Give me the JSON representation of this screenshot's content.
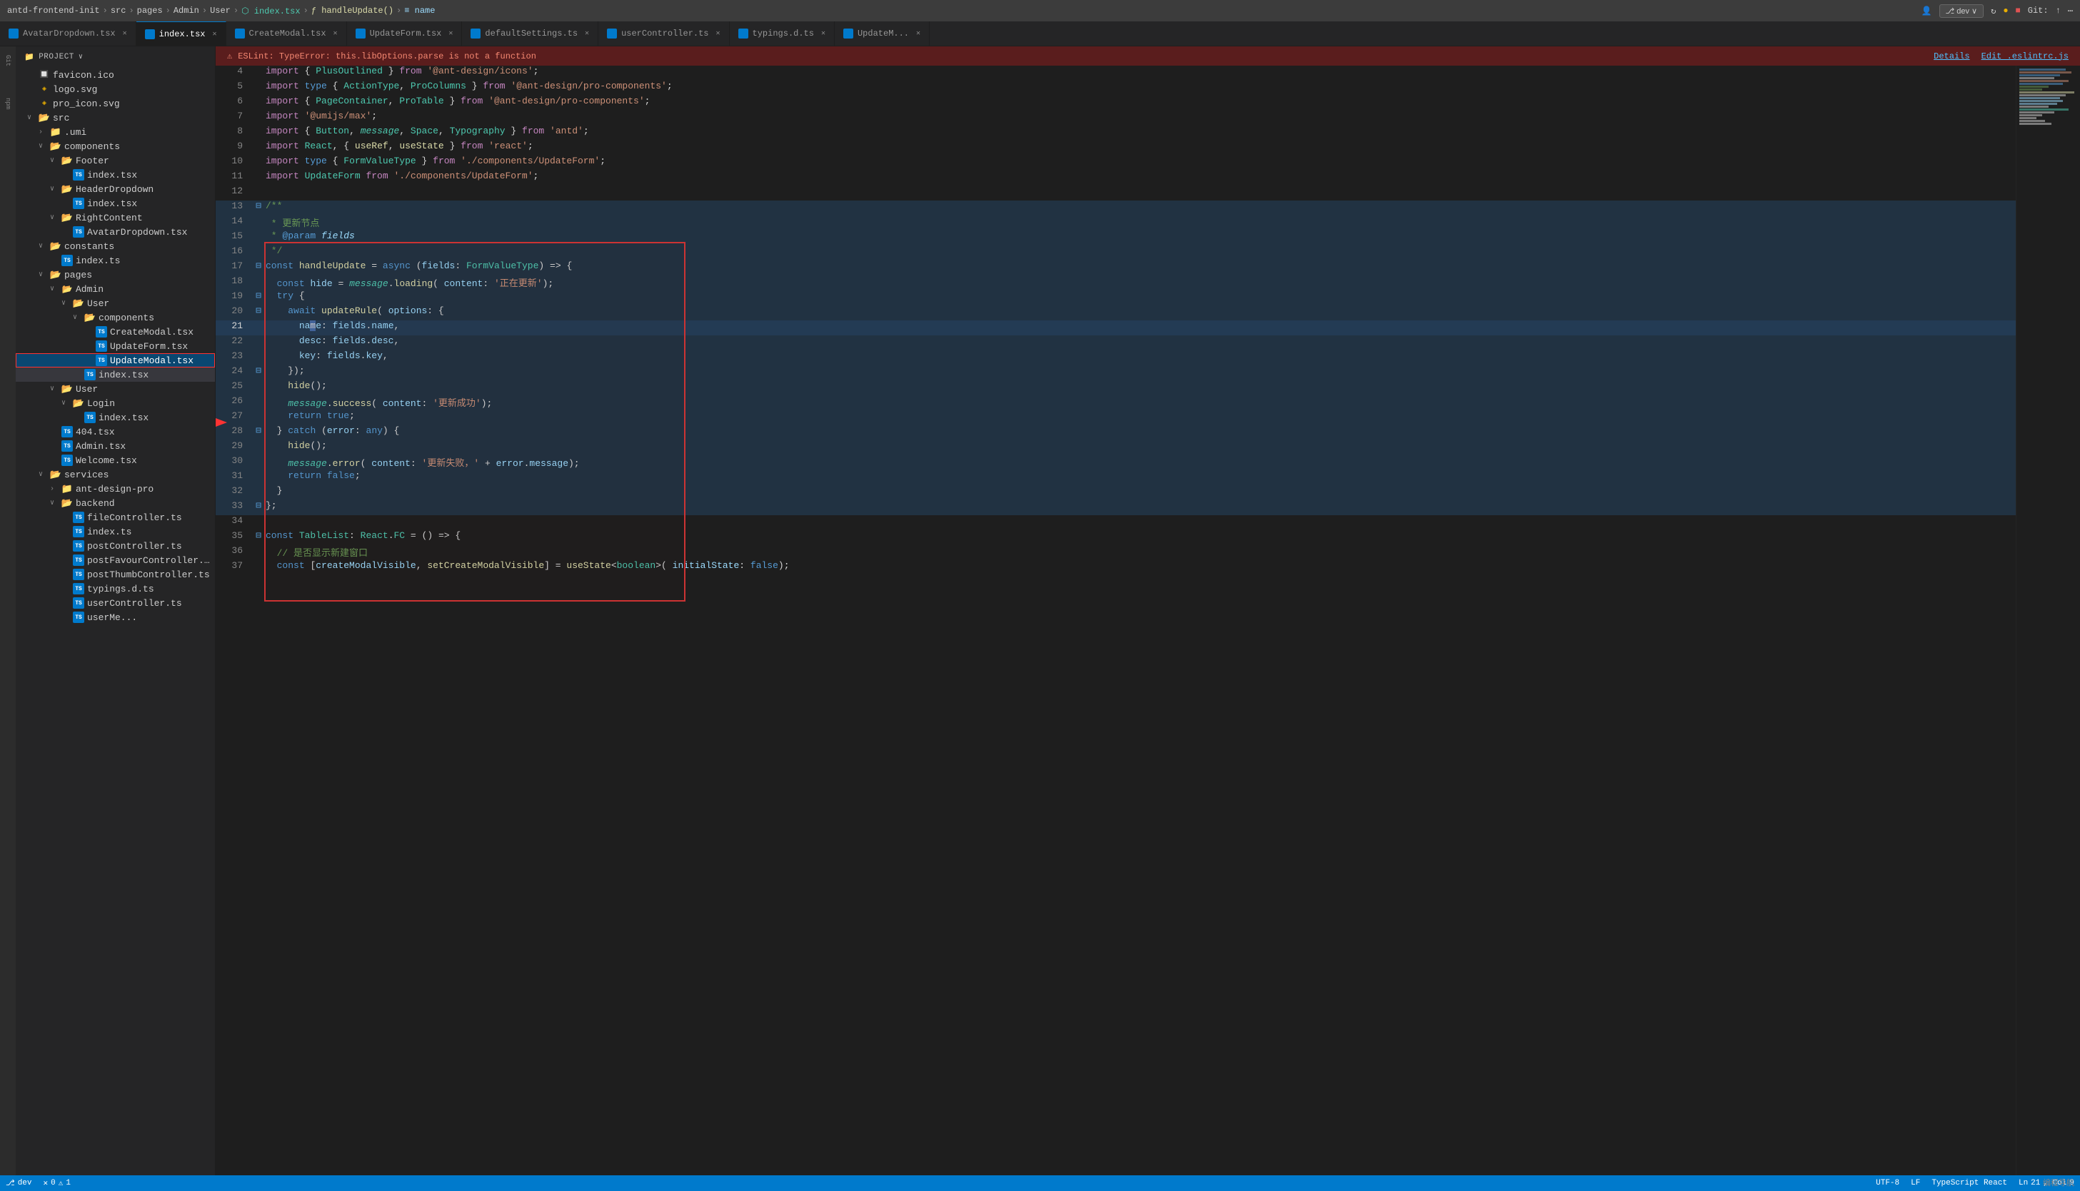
{
  "topbar": {
    "breadcrumb": [
      "antd-frontend-init",
      "src",
      "pages",
      "Admin",
      "User",
      "index.tsx",
      "handleUpdate()",
      "name"
    ],
    "rightItems": [
      "user-icon",
      "dev",
      "branch-icon",
      "git-label"
    ],
    "git_label": "Git:"
  },
  "tabs": [
    {
      "label": "AvatarDropdown.tsx",
      "type": "tsx",
      "active": false,
      "dirty": false
    },
    {
      "label": "index.tsx",
      "type": "tsx",
      "active": true,
      "dirty": false
    },
    {
      "label": "CreateModal.tsx",
      "type": "tsx",
      "active": false,
      "dirty": false
    },
    {
      "label": "UpdateForm.tsx",
      "type": "tsx",
      "active": false,
      "dirty": false
    },
    {
      "label": "defaultSettings.ts",
      "type": "ts",
      "active": false,
      "dirty": false
    },
    {
      "label": "userController.ts",
      "type": "ts",
      "active": false,
      "dirty": false
    },
    {
      "label": "typings.d.ts",
      "type": "ts",
      "active": false,
      "dirty": false
    },
    {
      "label": "UpdateM...",
      "type": "tsx",
      "active": false,
      "dirty": false
    }
  ],
  "error_banner": {
    "icon": "⚠",
    "text": "ESLint: TypeError: this.libOptions.parse is not a function",
    "details_label": "Details",
    "edit_label": "Edit .eslintrc.js"
  },
  "sidebar": {
    "header": "Project",
    "items": [
      {
        "label": "favicon.ico",
        "type": "ico",
        "depth": 1,
        "expanded": false
      },
      {
        "label": "logo.svg",
        "type": "svg",
        "depth": 1
      },
      {
        "label": "pro_icon.svg",
        "type": "svg",
        "depth": 1
      },
      {
        "label": "src",
        "type": "folder",
        "depth": 1,
        "expanded": true
      },
      {
        "label": ".umi",
        "type": "folder",
        "depth": 2,
        "expanded": false
      },
      {
        "label": "components",
        "type": "folder",
        "depth": 2,
        "expanded": true
      },
      {
        "label": "Footer",
        "type": "folder",
        "depth": 3,
        "expanded": true
      },
      {
        "label": "index.tsx",
        "type": "tsx",
        "depth": 4
      },
      {
        "label": "HeaderDropdown",
        "type": "folder",
        "depth": 3,
        "expanded": true
      },
      {
        "label": "index.tsx",
        "type": "tsx",
        "depth": 4
      },
      {
        "label": "RightContent",
        "type": "folder",
        "depth": 3,
        "expanded": true
      },
      {
        "label": "AvatarDropdown.tsx",
        "type": "tsx",
        "depth": 4
      },
      {
        "label": "constants",
        "type": "folder",
        "depth": 2,
        "expanded": true
      },
      {
        "label": "index.ts",
        "type": "ts",
        "depth": 3
      },
      {
        "label": "pages",
        "type": "folder",
        "depth": 2,
        "expanded": true
      },
      {
        "label": "Admin",
        "type": "folder",
        "depth": 3,
        "expanded": true
      },
      {
        "label": "User",
        "type": "folder",
        "depth": 4,
        "expanded": true
      },
      {
        "label": "components",
        "type": "folder",
        "depth": 5,
        "expanded": true
      },
      {
        "label": "CreateModal.tsx",
        "type": "tsx",
        "depth": 6
      },
      {
        "label": "UpdateForm.tsx",
        "type": "tsx",
        "depth": 6
      },
      {
        "label": "UpdateModal.tsx",
        "type": "tsx",
        "depth": 6,
        "selected": true
      },
      {
        "label": "index.tsx",
        "type": "tsx",
        "depth": 5,
        "highlighted": true
      },
      {
        "label": "User",
        "type": "folder",
        "depth": 3,
        "expanded": true
      },
      {
        "label": "Login",
        "type": "folder",
        "depth": 4,
        "expanded": true
      },
      {
        "label": "index.tsx",
        "type": "tsx",
        "depth": 5
      },
      {
        "label": "404.tsx",
        "type": "tsx",
        "depth": 3
      },
      {
        "label": "Admin.tsx",
        "type": "tsx",
        "depth": 3
      },
      {
        "label": "Welcome.tsx",
        "type": "tsx",
        "depth": 3
      },
      {
        "label": "services",
        "type": "folder",
        "depth": 2,
        "expanded": true
      },
      {
        "label": "ant-design-pro",
        "type": "folder",
        "depth": 3,
        "expanded": false
      },
      {
        "label": "backend",
        "type": "folder",
        "depth": 3,
        "expanded": true
      },
      {
        "label": "fileController.ts",
        "type": "ts",
        "depth": 4
      },
      {
        "label": "index.ts",
        "type": "ts",
        "depth": 4
      },
      {
        "label": "postController.ts",
        "type": "ts",
        "depth": 4
      },
      {
        "label": "postFavourController.ts",
        "type": "ts",
        "depth": 4
      },
      {
        "label": "postThumbController.ts",
        "type": "ts",
        "depth": 4
      },
      {
        "label": "typings.d.ts",
        "type": "ts",
        "depth": 4
      },
      {
        "label": "userController.ts",
        "type": "ts",
        "depth": 4
      },
      {
        "label": "userMe...",
        "type": "ts",
        "depth": 4
      }
    ]
  },
  "code": {
    "lines": [
      {
        "num": 4,
        "content": "import { PlusOutlined } from '@ant-design/icons';"
      },
      {
        "num": 5,
        "content": "import type { ActionType, ProColumns } from '@ant-design/pro-components';"
      },
      {
        "num": 6,
        "content": "import { PageContainer, ProTable } from '@ant-design/pro-components';"
      },
      {
        "num": 7,
        "content": "import '@umijs/max';"
      },
      {
        "num": 8,
        "content": "import { Button, message, Space, Typography } from 'antd';"
      },
      {
        "num": 9,
        "content": "import React, { useRef, useState } from 'react';"
      },
      {
        "num": 10,
        "content": "import type { FormValueType } from './components/UpdateForm';"
      },
      {
        "num": 11,
        "content": "import UpdateForm from './components/UpdateForm';"
      },
      {
        "num": 12,
        "content": ""
      },
      {
        "num": 13,
        "content": "/**"
      },
      {
        "num": 14,
        "content": " * 更新节点"
      },
      {
        "num": 15,
        "content": " * @param fields"
      },
      {
        "num": 16,
        "content": " */"
      },
      {
        "num": 17,
        "content": "const handleUpdate = async (fields: FormValueType) => {"
      },
      {
        "num": 18,
        "content": "  const hide = message.loading( content: '正在更新');"
      },
      {
        "num": 19,
        "content": "  try {"
      },
      {
        "num": 20,
        "content": "    await updateRule( options: {"
      },
      {
        "num": 21,
        "content": "      name: fields.name,"
      },
      {
        "num": 22,
        "content": "      desc: fields.desc,"
      },
      {
        "num": 23,
        "content": "      key: fields.key,"
      },
      {
        "num": 24,
        "content": "    });"
      },
      {
        "num": 25,
        "content": "    hide();"
      },
      {
        "num": 26,
        "content": "    message.success( content: '更新成功');"
      },
      {
        "num": 27,
        "content": "    return true;"
      },
      {
        "num": 28,
        "content": "  } catch (error: any) {"
      },
      {
        "num": 29,
        "content": "    hide();"
      },
      {
        "num": 30,
        "content": "    message.error( content: '更新失败，' + error.message);"
      },
      {
        "num": 31,
        "content": "    return false;"
      },
      {
        "num": 32,
        "content": "  }"
      },
      {
        "num": 33,
        "content": "};"
      },
      {
        "num": 34,
        "content": ""
      },
      {
        "num": 35,
        "content": "const TableList: React.FC = () => {"
      },
      {
        "num": 36,
        "content": "  // 是否显示新建窗口"
      },
      {
        "num": 37,
        "content": "  const [createModalVisible, setCreateModalVisible] = useState<boolean>( initialState: false);"
      }
    ]
  },
  "status_bar": {
    "branch": "dev",
    "errors": "0",
    "warnings": "1",
    "encoding": "UTF-8",
    "line_ending": "LF",
    "language": "TypeScript React",
    "line": "21",
    "col": "9"
  }
}
